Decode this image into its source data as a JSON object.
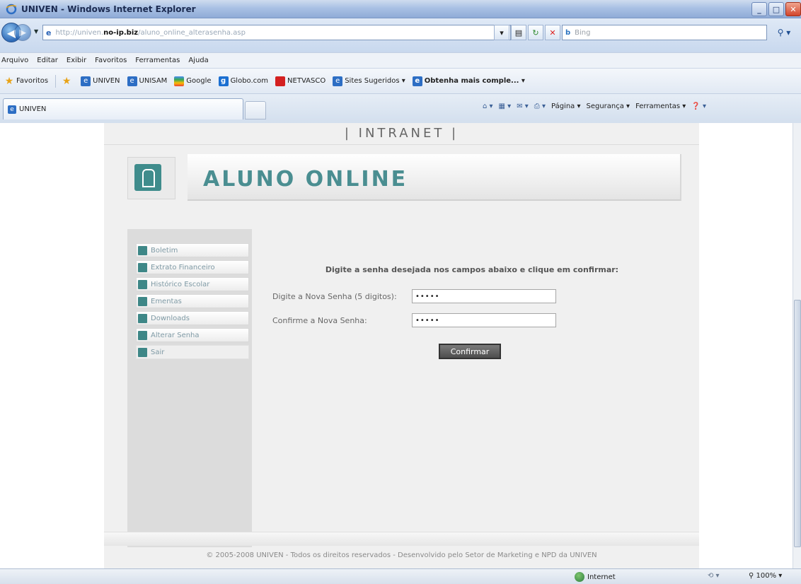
{
  "window": {
    "title": "UNIVEN - Windows Internet Explorer",
    "minimize": "_",
    "maximize": "□",
    "close": "✕"
  },
  "address": {
    "url_prefix": "http://univen.",
    "url_host": "no-ip.biz",
    "url_path": "/aluno_online_alterasenha.asp",
    "search_placeholder": "Bing"
  },
  "menu": [
    "Arquivo",
    "Editar",
    "Exibir",
    "Favoritos",
    "Ferramentas",
    "Ajuda"
  ],
  "favorites": {
    "label": "Favoritos",
    "items": [
      {
        "label": "UNIVEN",
        "icon": "ie-page-icon"
      },
      {
        "label": "UNISAM",
        "icon": "ie-page-icon"
      },
      {
        "label": "Google",
        "icon": "google-icon"
      },
      {
        "label": "Globo.com",
        "icon": "globo-icon"
      },
      {
        "label": "NETVASCO",
        "icon": "netvasco-icon"
      },
      {
        "label": "Sites Sugeridos ▾",
        "icon": "ie-page-icon"
      },
      {
        "label": "Obtenha mais comple... ▾",
        "icon": "ie-page-icon"
      }
    ]
  },
  "tab": {
    "label": "UNIVEN"
  },
  "commands": [
    "Página ▾",
    "Segurança ▾",
    "Ferramentas ▾"
  ],
  "page": {
    "header": "| INTRANET |",
    "banner_title": "ALUNO ONLINE",
    "sidebar": [
      "Boletim",
      "Extrato Financeiro",
      "Histórico Escolar",
      "Ementas",
      "Downloads",
      "Alterar Senha",
      "Sair"
    ],
    "form": {
      "message": "Digite a senha desejada nos campos abaixo e clique em confirmar:",
      "new_password_label": "Digite a Nova Senha (5 digitos):",
      "new_password_value": "•••••",
      "confirm_password_label": "Confirme a Nova Senha:",
      "confirm_password_value": "•••••",
      "confirm_button": "Confirmar"
    },
    "footer": "© 2005-2008 UNIVEN - Todos os direitos reservados - Desenvolvido pelo Setor de Marketing e NPD da UNIVEN"
  },
  "status": {
    "zone": "Internet",
    "zoom": "100%"
  }
}
